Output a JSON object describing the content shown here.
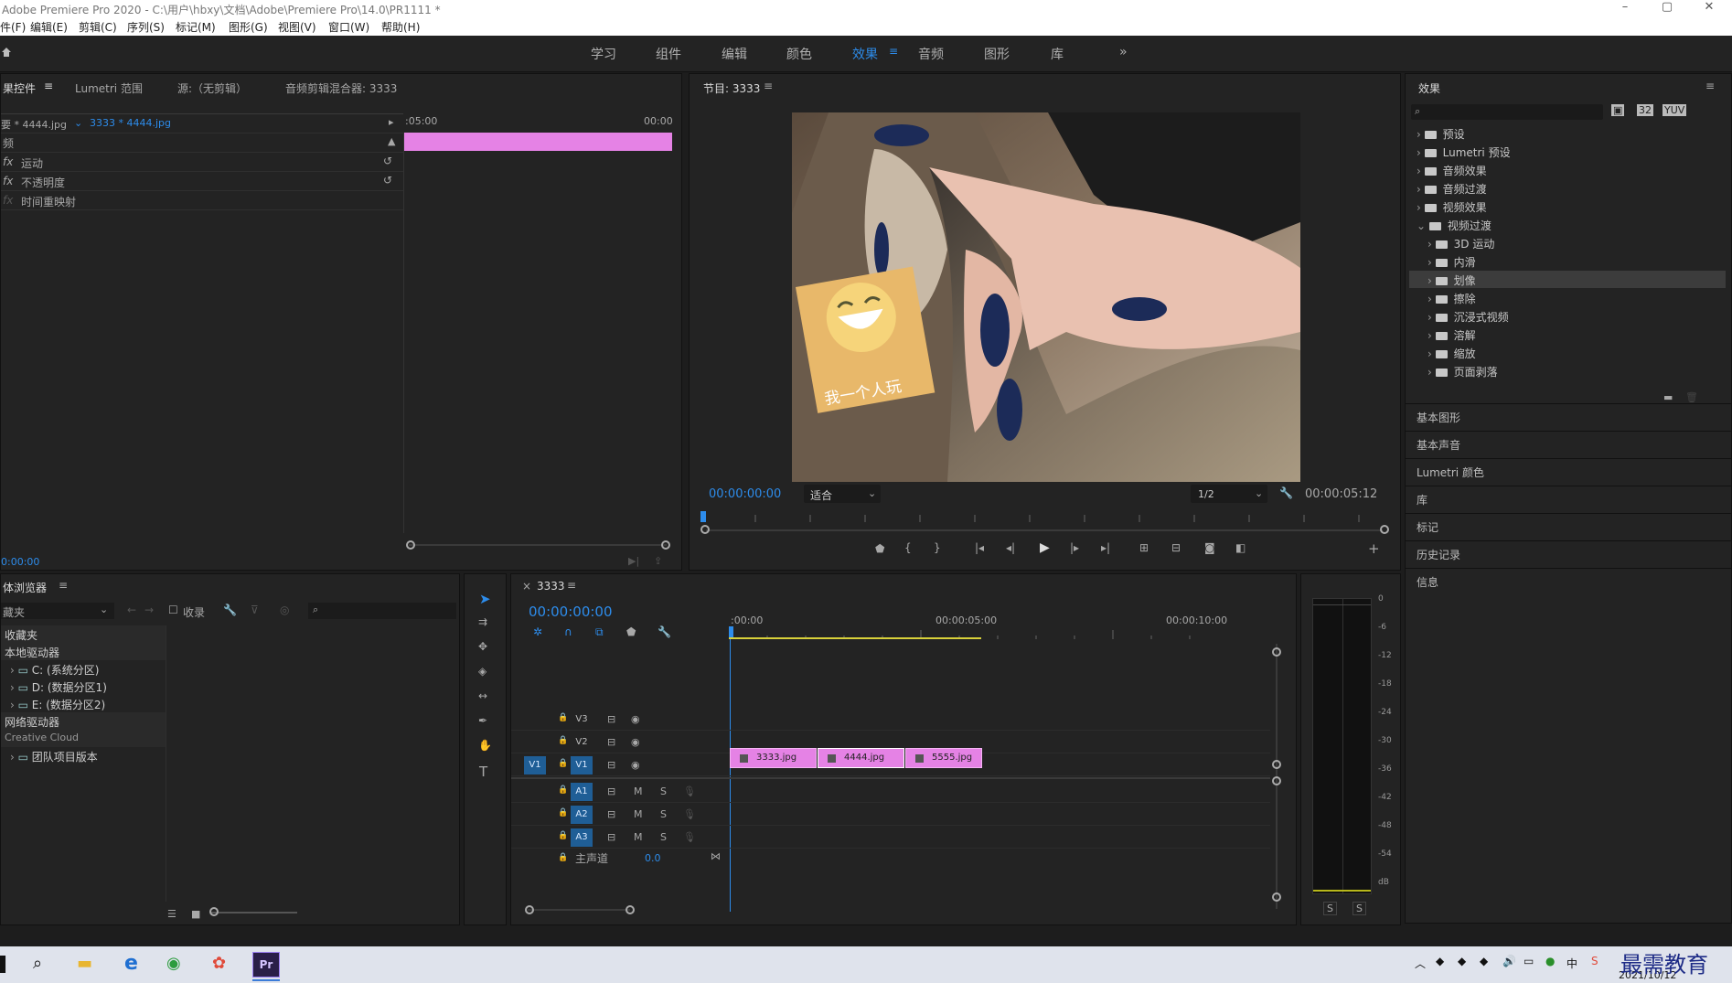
{
  "window": {
    "title": "Adobe Premiere Pro 2020 - C:\\用户\\hbxy\\文档\\Adobe\\Premiere Pro\\14.0\\PR1111 *"
  },
  "menu": [
    "件(F)",
    "编辑(E)",
    "剪辑(C)",
    "序列(S)",
    "标记(M)",
    "图形(G)",
    "视图(V)",
    "窗口(W)",
    "帮助(H)"
  ],
  "workspaces": [
    "学习",
    "组件",
    "编辑",
    "颜色",
    "效果",
    "音频",
    "图形",
    "库"
  ],
  "active_workspace": "效果",
  "effect_controls": {
    "tabs": [
      "果控件",
      "Lumetri 范围",
      "源:（无剪辑）",
      "音频剪辑混合器: 3333"
    ],
    "clip_path": "要 * 4444.jpg",
    "clip_sequence": "3333 * 4444.jpg",
    "ruler_start": ":05:00",
    "ruler_end": "00:00",
    "section_video": "频",
    "props": [
      "运动",
      "不透明度",
      "时间重映射"
    ],
    "fx_label": "fx",
    "timecode": "0:00:00"
  },
  "program": {
    "title": "节目: 3333",
    "timecode": "00:00:00:00",
    "fit": "适合",
    "quality": "1/2",
    "duration": "00:00:05:12",
    "sticker_text": "我一个人玩"
  },
  "effects_panel": {
    "title": "效果",
    "top": [
      {
        "label": "预设",
        "kind": "preset"
      },
      {
        "label": "Lumetri 预设",
        "kind": "preset"
      },
      {
        "label": "音频效果",
        "kind": "folder"
      },
      {
        "label": "音频过渡",
        "kind": "folder"
      },
      {
        "label": "视频效果",
        "kind": "folder"
      },
      {
        "label": "视频过渡",
        "kind": "folder",
        "open": true
      }
    ],
    "children": [
      "3D 运动",
      "内滑",
      "划像",
      "擦除",
      "沉浸式视频",
      "溶解",
      "缩放",
      "页面剥落"
    ],
    "selected_child": "划像",
    "collapsed_panels": [
      "基本图形",
      "基本声音",
      "Lumetri 颜色",
      "库",
      "标记",
      "历史记录",
      "信息"
    ]
  },
  "media_browser": {
    "title": "体浏览器",
    "dropdown": "藏夹",
    "ingest": "收录",
    "groups": [
      {
        "label": "收藏夹"
      },
      {
        "label": "本地驱动器"
      },
      {
        "label": "C: (系统分区)",
        "child": true
      },
      {
        "label": "D: (数据分区1)",
        "child": true
      },
      {
        "label": "E: (数据分区2)",
        "child": true
      },
      {
        "label": "网络驱动器"
      },
      {
        "label": "Creative Cloud",
        "small": true
      },
      {
        "label": "团队项目版本",
        "child": true
      }
    ]
  },
  "timeline": {
    "sequence": "3333",
    "timecode": "00:00:00:00",
    "ruler": [
      ":00:00",
      "00:00:05:00",
      "00:00:10:00"
    ],
    "video_tracks": [
      "V3",
      "V2",
      "V1"
    ],
    "audio_tracks": [
      "A1",
      "A2",
      "A3"
    ],
    "master": "主声道",
    "master_value": "0.0",
    "clips": [
      "3333.jpg",
      "4444.jpg",
      "5555.jpg"
    ],
    "m_label": "M",
    "s_label": "S"
  },
  "meter": {
    "scale": [
      "0",
      "-6",
      "-12",
      "-18",
      "-24",
      "-30",
      "-36",
      "-42",
      "-48",
      "-54",
      "dB"
    ],
    "solo": [
      "S",
      "S"
    ]
  },
  "taskbar": {
    "ime": "中",
    "date": "2021/10/12",
    "watermark": "最需教育"
  }
}
